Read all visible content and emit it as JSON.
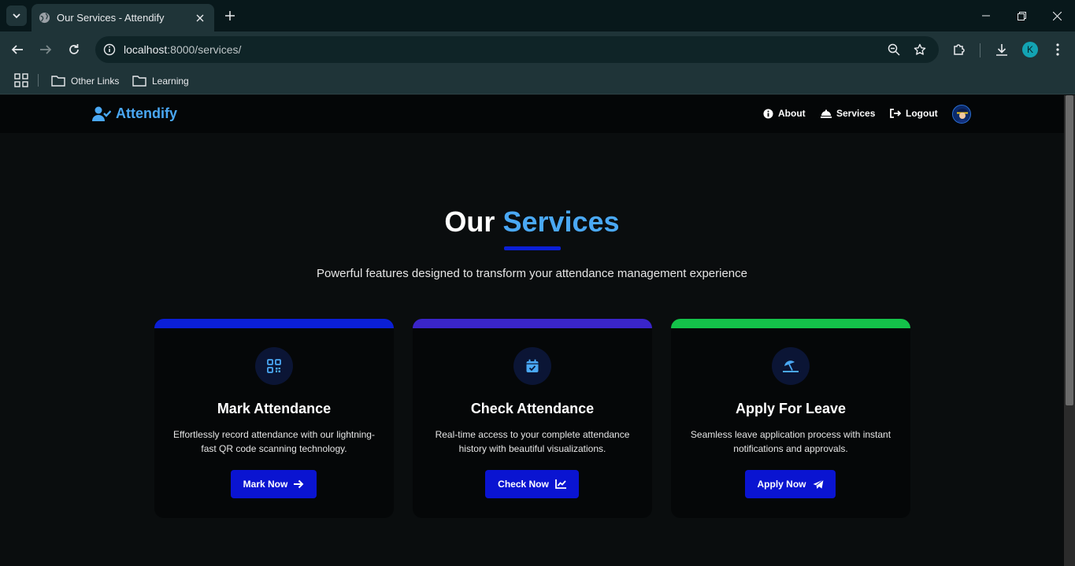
{
  "browser": {
    "tab_title": "Our Services - Attendify",
    "url_host": "localhost",
    "url_rest": ":8000/services/",
    "profile_initial": "K",
    "bookmarks": [
      {
        "label": "Other Links",
        "icon": "folder-icon"
      },
      {
        "label": "Learning",
        "icon": "folder-icon"
      }
    ]
  },
  "navbar": {
    "brand": "Attendify",
    "links": [
      {
        "label": "About",
        "icon": "info-icon"
      },
      {
        "label": "Services",
        "icon": "concierge-bell-icon"
      },
      {
        "label": "Logout",
        "icon": "sign-out-icon"
      }
    ]
  },
  "hero": {
    "title_plain": "Our",
    "title_accent": "Services",
    "subtitle": "Powerful features designed to transform your attendance management experience"
  },
  "cards": [
    {
      "title": "Mark Attendance",
      "description": "Effortlessly record attendance with our lightning-fast QR code scanning technology.",
      "button": "Mark Now",
      "icon": "qrcode-icon",
      "button_icon": "arrow-right-icon",
      "accent_color": "#0b1fd6"
    },
    {
      "title": "Check Attendance",
      "description": "Real-time access to your complete attendance history with beautiful visualizations.",
      "button": "Check Now",
      "icon": "calendar-check-icon",
      "button_icon": "chart-line-icon",
      "accent_color": "#3a25c9"
    },
    {
      "title": "Apply For Leave",
      "description": "Seamless leave application process with instant notifications and approvals.",
      "button": "Apply Now",
      "icon": "umbrella-beach-icon",
      "button_icon": "paper-plane-icon",
      "accent_color": "#14c24a"
    }
  ],
  "colors": {
    "accent_blue": "#4aa8f4",
    "button_blue": "#0a14d1",
    "page_bg": "#0a0d0e"
  }
}
